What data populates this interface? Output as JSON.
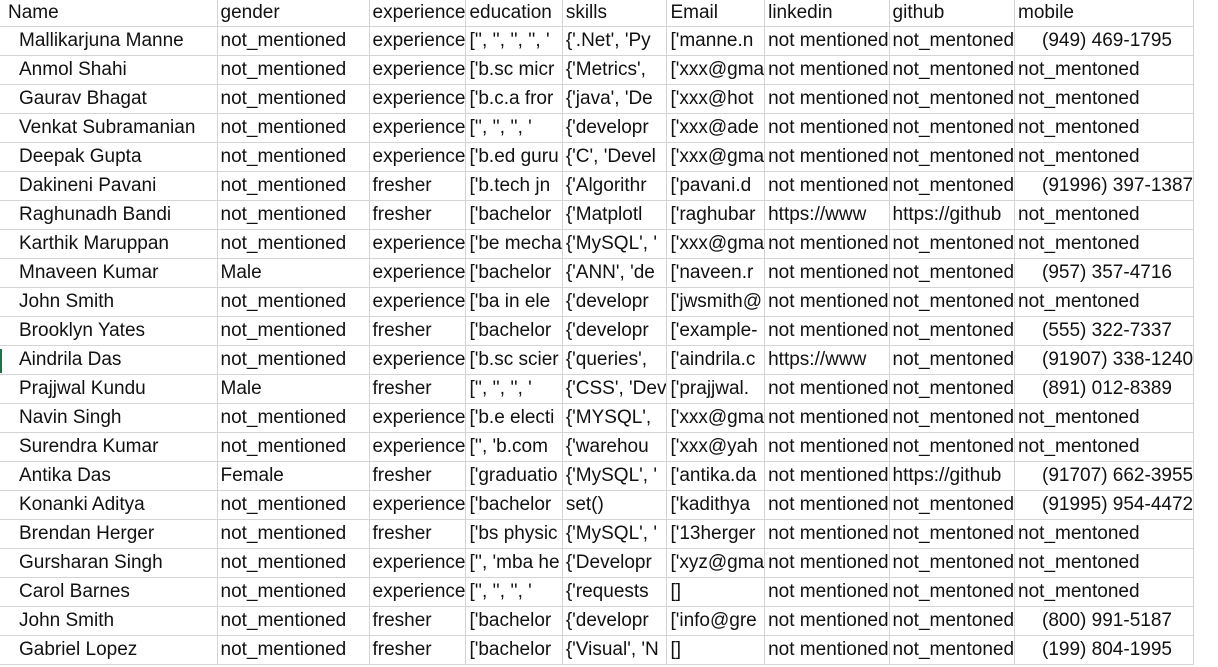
{
  "sheet": {
    "headers": [
      "Name",
      "gender",
      "experience",
      "education",
      "skills",
      "Email",
      "linkedin",
      "github",
      "mobile"
    ],
    "rows": [
      [
        "Mallikarjuna Manne",
        "not_mentioned",
        "experience",
        "['', '', '', '', '",
        "{'.Net', 'Py",
        "['manne.n",
        "not mentioned",
        "not_mentoned",
        "(949) 469-1795"
      ],
      [
        "Anmol Shahi",
        "not_mentioned",
        "experience",
        "['b.sc micr",
        "{'Metrics',",
        "['xxx@gma",
        "not mentioned",
        "not_mentoned",
        "not_mentoned"
      ],
      [
        "Gaurav Bhagat",
        "not_mentioned",
        "experience",
        "['b.c.a fror",
        "{'java', 'De",
        "['xxx@hot",
        "not mentioned",
        "not_mentoned",
        "not_mentoned"
      ],
      [
        "Venkat Subramanian",
        "not_mentioned",
        "experience",
        "['', '', '', '",
        "{'developr",
        "['xxx@ade",
        "not mentioned",
        "not_mentoned",
        "not_mentoned"
      ],
      [
        "Deepak Gupta",
        "not_mentioned",
        "experience",
        "['b.ed guru",
        "{'C', 'Devel",
        "['xxx@gma",
        "not mentioned",
        "not_mentoned",
        "not_mentoned"
      ],
      [
        "Dakineni Pavani",
        "not_mentioned",
        "fresher",
        "['b.tech jn",
        "{'Algorithr",
        "['pavani.d",
        "not mentioned",
        "not_mentoned",
        "(91996) 397-1387"
      ],
      [
        "Raghunadh Bandi",
        "not_mentioned",
        "fresher",
        "['bachelor",
        "{'Matplotl",
        "['raghubar",
        "https://www",
        "https://github",
        "not_mentoned"
      ],
      [
        "Karthik Maruppan",
        "not_mentioned",
        "experience",
        "['be mecha",
        "{'MySQL', '",
        "['xxx@gma",
        "not mentioned",
        "not_mentoned",
        "not_mentoned"
      ],
      [
        "Mnaveen Kumar",
        "Male",
        "experience",
        "['bachelor",
        "{'ANN', 'de",
        "['naveen.r",
        "not mentioned",
        "not_mentoned",
        "(957) 357-4716"
      ],
      [
        "John Smith",
        "not_mentioned",
        "experience",
        "['ba in ele",
        "{'developr",
        "['jwsmith@",
        "not mentioned",
        "not_mentoned",
        "not_mentoned"
      ],
      [
        "Brooklyn Yates",
        "not_mentioned",
        "fresher",
        "['bachelor",
        "{'developr",
        "['example-",
        "not mentioned",
        "not_mentoned",
        "(555) 322-7337"
      ],
      [
        "Aindrila Das",
        "not_mentioned",
        "experience",
        "['b.sc scier",
        "{'queries',",
        "['aindrila.c",
        "https://www",
        "not_mentoned",
        "(91907) 338-1240"
      ],
      [
        "Prajjwal Kundu",
        "Male",
        "fresher",
        "['', '', '', '",
        "{'CSS', 'Dev",
        "['prajjwal.",
        "not mentioned",
        "not_mentoned",
        "(891) 012-8389"
      ],
      [
        "Navin Singh",
        "not_mentioned",
        "experience",
        "['b.e electi",
        "{'MYSQL',",
        "['xxx@gma",
        "not mentioned",
        "not_mentoned",
        "not_mentoned"
      ],
      [
        "Surendra Kumar",
        "not_mentioned",
        "experience",
        "['', 'b.com",
        "{'warehou",
        "['xxx@yah",
        "not mentioned",
        "not_mentoned",
        "not_mentoned"
      ],
      [
        "Antika Das",
        "Female",
        "fresher",
        "['graduatio",
        "{'MySQL', '",
        "['antika.da",
        "not mentioned",
        "https://github",
        "(91707) 662-3955"
      ],
      [
        "Konanki Aditya",
        "not_mentioned",
        "experience",
        "['bachelor",
        "set()",
        "['kadithya",
        "not mentioned",
        "not_mentoned",
        "(91995) 954-4472"
      ],
      [
        "Brendan Herger",
        "not_mentioned",
        "fresher",
        "['bs physic",
        "{'MySQL', '",
        "['13herger",
        "not mentioned",
        "not_mentoned",
        "not_mentoned"
      ],
      [
        "Gursharan Singh",
        "not_mentioned",
        "experience",
        "['', 'mba he",
        "{'Developr",
        "['xyz@gma",
        "not mentioned",
        "not_mentoned",
        "not_mentoned"
      ],
      [
        "Carol Barnes",
        "not_mentioned",
        "experience",
        "['', '', '', '",
        "{'requests",
        "[]",
        "not mentioned",
        "not_mentoned",
        "not_mentoned"
      ],
      [
        "John Smith",
        "not_mentioned",
        "fresher",
        "['bachelor",
        "{'developr",
        "['info@gre",
        "not mentioned",
        "not_mentoned",
        "(800) 991-5187"
      ],
      [
        "Gabriel Lopez",
        "not_mentioned",
        "fresher",
        "['bachelor",
        "{'Visual', 'N",
        "[]",
        "not mentioned",
        "not_mentoned",
        "(199) 804-1995"
      ]
    ]
  },
  "colors": {
    "gridline": "#d4d4d4",
    "text": "#111111",
    "active_marker": "#1e7145"
  }
}
